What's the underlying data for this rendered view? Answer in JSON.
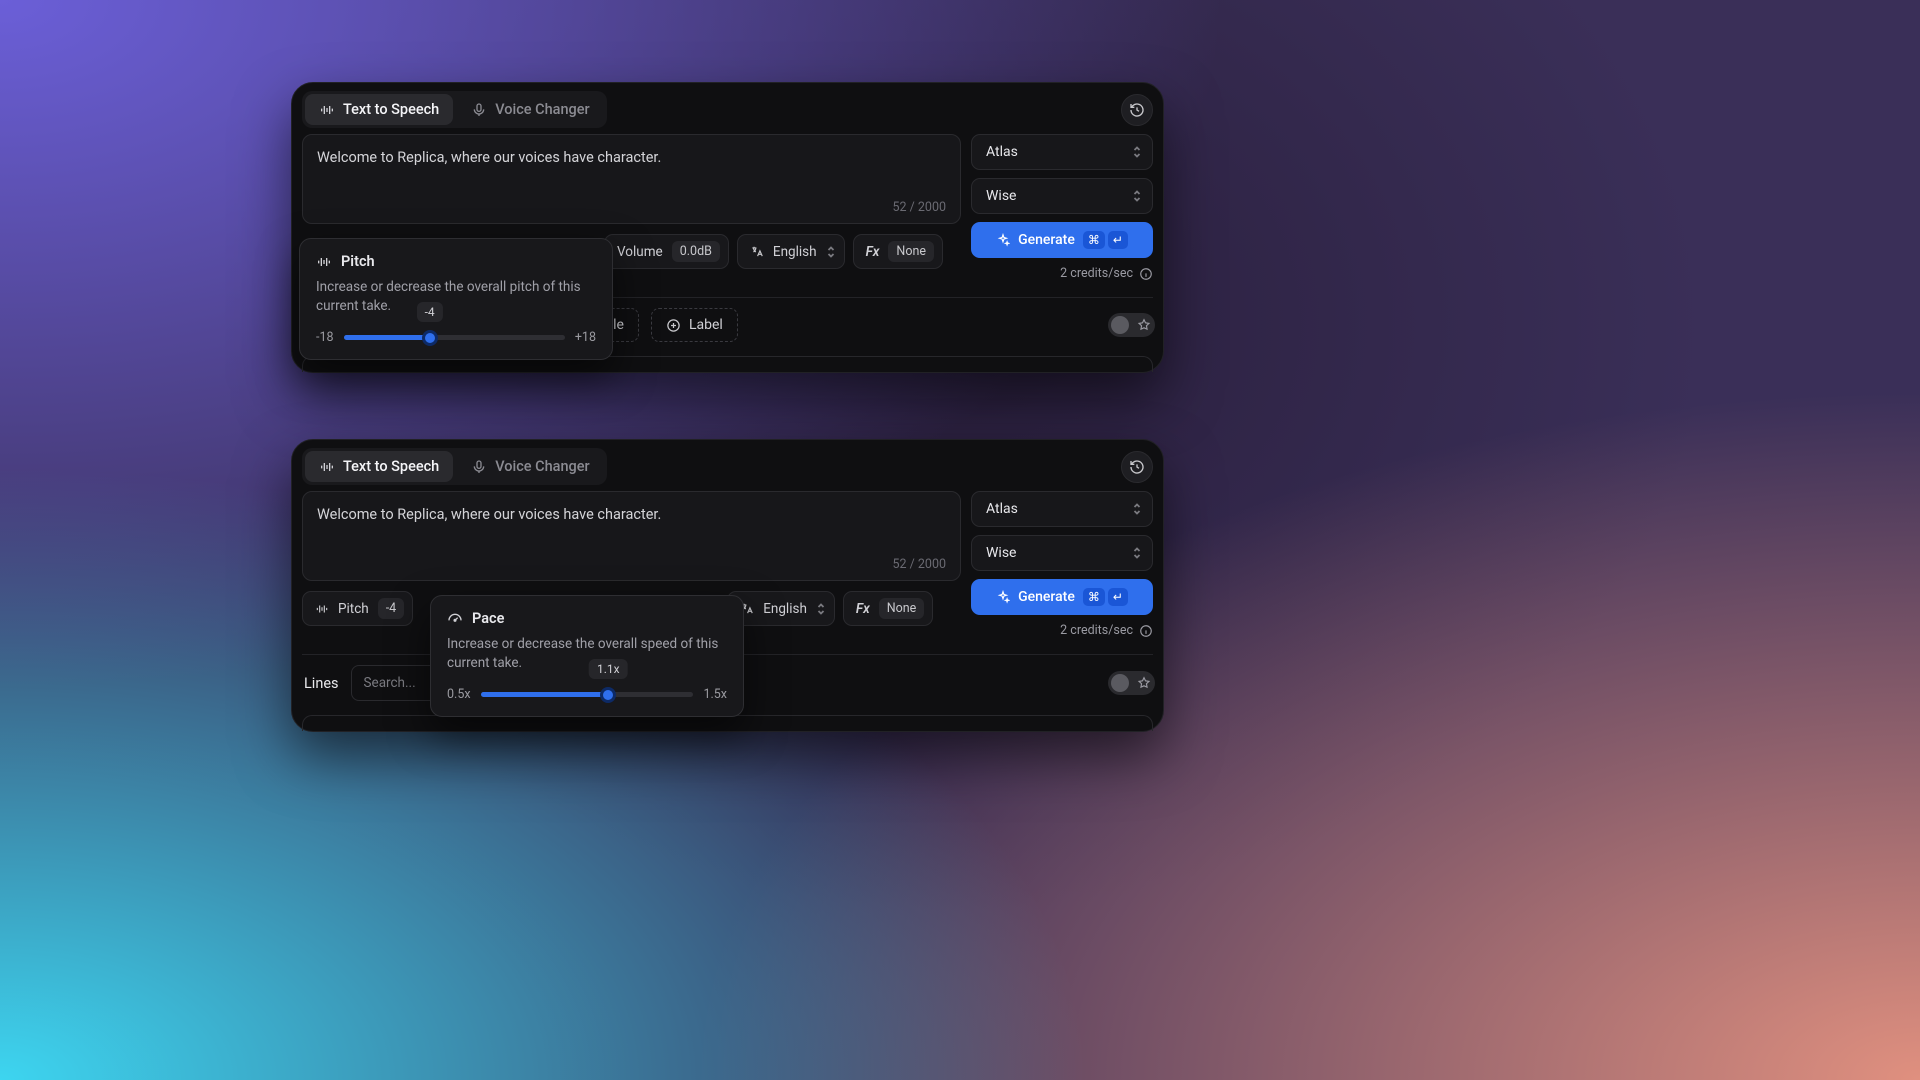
{
  "tabs": {
    "tts": "Text to Speech",
    "vc": "Voice Changer"
  },
  "text_input": {
    "value": "Welcome to Replica, where our voices have character.",
    "counter": "52 / 2000"
  },
  "chips": {
    "pitch_label": "Pitch",
    "pitch_value": "-4",
    "volume_label": "Volume",
    "volume_value": "0.0dB",
    "lang_label": "English",
    "fx_label": "Fx",
    "fx_value": "None"
  },
  "selects": {
    "voice": "Atlas",
    "style": "Wise"
  },
  "generate": {
    "label": "Generate",
    "k1": "⌘",
    "k2": "↵",
    "credits": "2 credits/sec"
  },
  "lines": {
    "label": "Lines",
    "search_placeholder": "Search...",
    "style_btn": "Style",
    "label_btn": "Label"
  },
  "popover_pitch": {
    "title": "Pitch",
    "desc": "Increase or decrease the overall pitch of this current take.",
    "badge": "-4",
    "min": "-18",
    "max": "+18",
    "fill_pct": 38.9,
    "thumb_pct": 38.9
  },
  "popover_pace": {
    "title": "Pace",
    "desc": "Increase or decrease the overall speed of this current take.",
    "badge": "1.1x",
    "min": "0.5x",
    "max": "1.5x",
    "fill_pct": 60,
    "thumb_pct": 60
  }
}
